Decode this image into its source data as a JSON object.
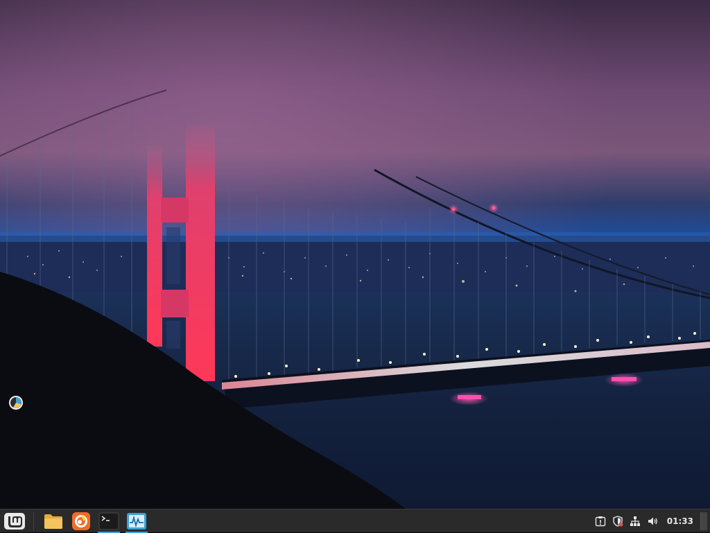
{
  "desktop": {
    "wallpaper": "golden-gate-bridge-night-fog",
    "icons": [
      {
        "icon": "chart-pie-icon"
      }
    ]
  },
  "taskbar": {
    "menu_icon": "mint-logo-icon",
    "launchers": [
      {
        "icon": "folder-icon",
        "running": false
      },
      {
        "icon": "firefox-icon",
        "running": false
      },
      {
        "icon": "terminal-icon",
        "running": true
      },
      {
        "icon": "system-monitor-icon",
        "running": true
      }
    ],
    "tray": {
      "icons": [
        "update-manager-icon",
        "shield-icon",
        "network-icon",
        "volume-icon"
      ],
      "clock": "01:33"
    }
  },
  "colors": {
    "taskbar_bg": "#2a2a2a",
    "running_indicator": "#3aa0d8",
    "folder": "#f3c35c",
    "firefox": "#f26b2a",
    "sysmon": "#3aa0d8"
  }
}
